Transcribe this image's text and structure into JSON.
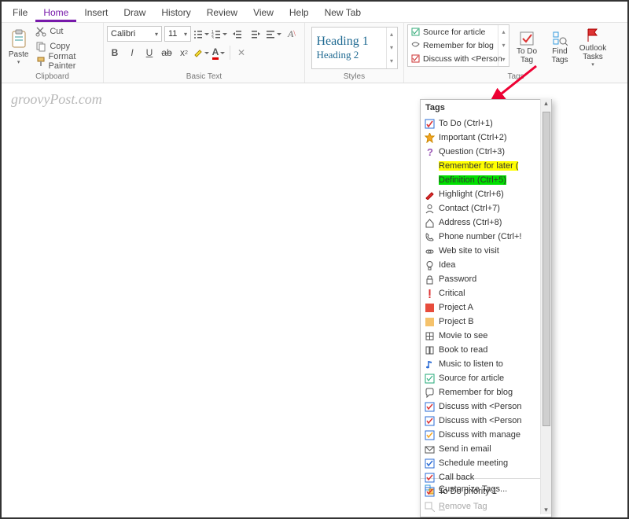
{
  "menu": {
    "items": [
      "File",
      "Home",
      "Insert",
      "Draw",
      "History",
      "Review",
      "View",
      "Help",
      "New Tab"
    ],
    "active": 1
  },
  "clipboard": {
    "label": "Clipboard",
    "paste": "Paste",
    "cut": "Cut",
    "copy": "Copy",
    "fp": "Format Painter"
  },
  "basic": {
    "label": "Basic Text",
    "font": "Calibri",
    "size": "11"
  },
  "styles": {
    "label": "Styles",
    "h1": "Heading 1",
    "h2": "Heading 2"
  },
  "tagsGroup": {
    "label": "Tags",
    "gallery": [
      "Source for article",
      "Remember for blog",
      "Discuss with <Person"
    ],
    "todo": "To Do Tag",
    "find": "Find Tags",
    "outlook": "Outlook Tasks"
  },
  "watermark": "groovyPost.com",
  "panel": {
    "title": "Tags",
    "items": [
      {
        "k": "todo",
        "t": "To Do (Ctrl+1)"
      },
      {
        "k": "star",
        "t": "Important (Ctrl+2)"
      },
      {
        "k": "question",
        "t": "Question (Ctrl+3)"
      },
      {
        "k": "blank",
        "t": "Remember for later (",
        "hl": "hl-yellow"
      },
      {
        "k": "blank",
        "t": "Definition (Ctrl+5)",
        "hl": "hl-green"
      },
      {
        "k": "pencil",
        "t": "Highlight (Ctrl+6)"
      },
      {
        "k": "contact",
        "t": "Contact (Ctrl+7)"
      },
      {
        "k": "home",
        "t": "Address (Ctrl+8)"
      },
      {
        "k": "phone",
        "t": "Phone number (Ctrl+!"
      },
      {
        "k": "link",
        "t": "Web site to visit"
      },
      {
        "k": "bulb",
        "t": "Idea"
      },
      {
        "k": "lock",
        "t": "Password"
      },
      {
        "k": "excl",
        "t": "Critical"
      },
      {
        "k": "sq-red",
        "t": "Project A"
      },
      {
        "k": "sq-amb",
        "t": "Project B"
      },
      {
        "k": "film",
        "t": "Movie to see"
      },
      {
        "k": "book",
        "t": "Book to read"
      },
      {
        "k": "note",
        "t": "Music to listen to"
      },
      {
        "k": "chk",
        "t": "Source for article"
      },
      {
        "k": "bubble",
        "t": "Remember for blog"
      },
      {
        "k": "chk-r",
        "t": "Discuss with <Person"
      },
      {
        "k": "chk-r",
        "t": "Discuss with <Person"
      },
      {
        "k": "chk-o",
        "t": "Discuss with manage"
      },
      {
        "k": "env",
        "t": "Send in email"
      },
      {
        "k": "chk-b",
        "t": "Schedule meeting"
      },
      {
        "k": "chk-r",
        "t": "Call back"
      },
      {
        "k": "chk-r",
        "t": "To Do priority 1"
      }
    ],
    "customize": "Customize Tags...",
    "remove": "Remove Tag"
  }
}
